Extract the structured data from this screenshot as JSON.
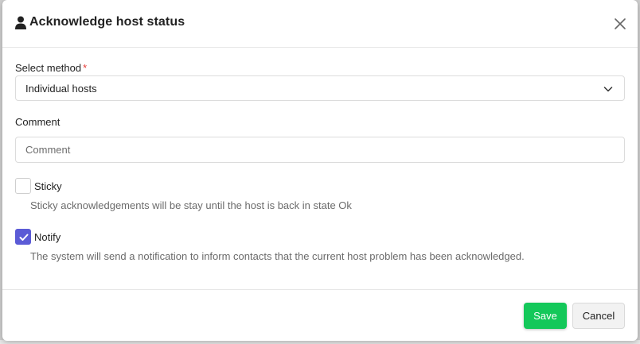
{
  "modal": {
    "title": "Acknowledge host status",
    "title_icon": "user-icon",
    "close_icon": "close-icon"
  },
  "method": {
    "label": "Select method",
    "required_marker": "*",
    "value": "Individual hosts",
    "icon": "chevron-down-icon"
  },
  "comment": {
    "label": "Comment",
    "placeholder": "Comment",
    "value": ""
  },
  "sticky": {
    "label": "Sticky",
    "checked": false,
    "help": "Sticky acknowledgements will be stay until the host is back in state Ok"
  },
  "notify": {
    "label": "Notify",
    "checked": true,
    "help": "The system will send a notification to inform contacts that the current host problem has been acknowledged."
  },
  "footer": {
    "save_label": "Save",
    "cancel_label": "Cancel"
  },
  "colors": {
    "accent": "#5b5bd6",
    "save": "#14c85a",
    "required": "#e53935"
  }
}
